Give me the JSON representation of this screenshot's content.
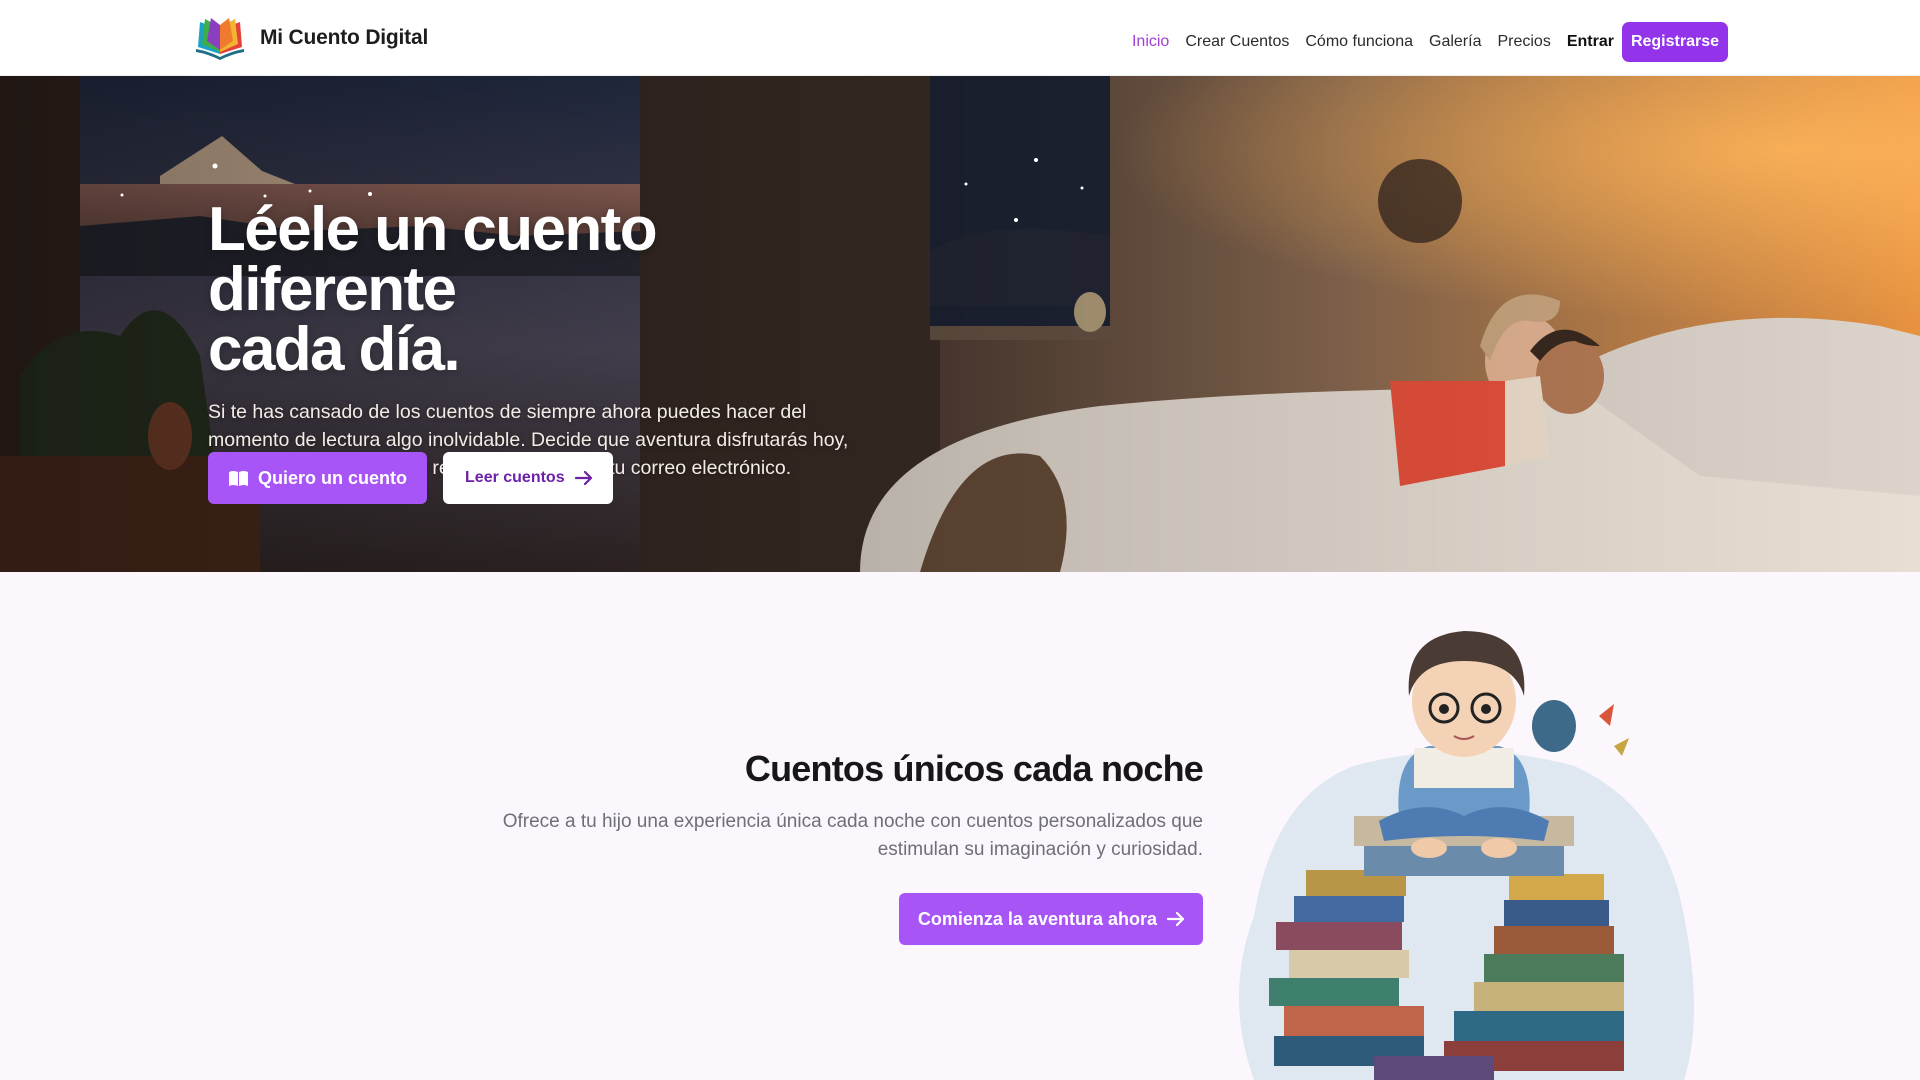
{
  "header": {
    "brand_name": "Mi Cuento Digital",
    "logo_icon": "open-book-icon",
    "nav": {
      "inicio": "Inicio",
      "crear_cuentos": "Crear Cuentos",
      "como_funciona": "Cómo funciona",
      "galeria": "Galería",
      "precios": "Precios",
      "entrar": "Entrar",
      "registrarse": "Registrarse"
    },
    "active_nav": "Inicio"
  },
  "hero": {
    "title_line1": "Léele un cuento diferente",
    "title_line2": "cada día.",
    "description": "Si te has cansado de los cuentos de siempre ahora puedes hacer del momento de lectura algo inolvidable. Decide que aventura disfrutarás hoy, selecciona el personaje y recibe un cuento en tu correo electrónico.",
    "primary_button": "Quiero un cuento",
    "primary_button_icon": "book-icon",
    "secondary_button": "Leer cuentos",
    "secondary_button_icon": "arrow-right-icon",
    "background_image": "mother-reading-to-child-in-bed-illustration"
  },
  "section2": {
    "title": "Cuentos únicos cada noche",
    "description": "Ofrece a tu hijo una experiencia única cada noche con cuentos personalizados que estimulan su imaginación y curiosidad.",
    "button": "Comienza la aventura ahora",
    "button_icon": "arrow-right-icon",
    "illustration": "boy-sitting-on-books-watercolor"
  },
  "colors": {
    "accent": "#a855f7",
    "accent_dark": "#9333ea",
    "active_nav": "#a03ed3",
    "section_bg": "#fbf7fd"
  }
}
